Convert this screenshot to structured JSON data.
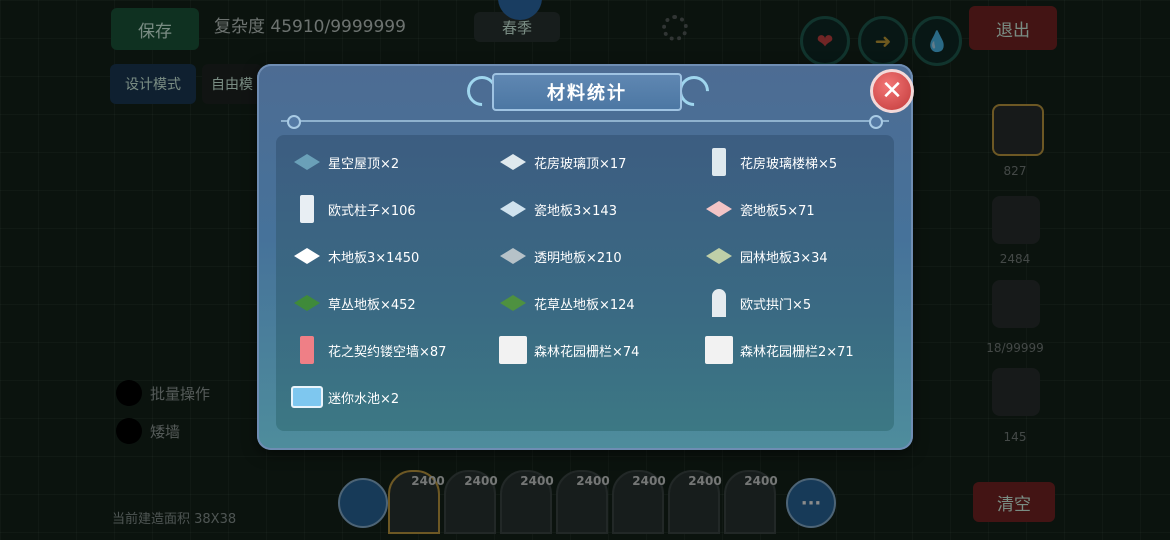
{
  "hud": {
    "save_label": "保存",
    "complexity_text": "复杂度 45910/9999999",
    "season_label": "春季",
    "exit_label": "退出",
    "design_mode_label": "设计模式",
    "free_mode_label": "自由模",
    "batch_label": "批量操作",
    "short_wall_label": "矮墙",
    "area_text": "当前建造面积 38X38",
    "clear_label": "清空",
    "more_label": "···"
  },
  "side_counts": [
    "827",
    "2484",
    "18/99999",
    "145"
  ],
  "bottom_counts": [
    "2400",
    "2400",
    "2400",
    "2400",
    "2400",
    "2400",
    "2400"
  ],
  "modal": {
    "title": "材料统计",
    "close_label": "✕",
    "items": [
      {
        "label": "星空屋顶×2",
        "icon": "starry-roof-icon",
        "color": "#6aa0b8"
      },
      {
        "label": "花房玻璃顶×17",
        "icon": "glass-roof-icon",
        "color": "#dfe9ee"
      },
      {
        "label": "花房玻璃楼梯×5",
        "icon": "glass-stairs-icon",
        "color": "#dfe9ee"
      },
      {
        "label": "欧式柱子×106",
        "icon": "column-icon",
        "color": "#e8eef3"
      },
      {
        "label": "瓷地板3×143",
        "icon": "tile-floor-icon",
        "color": "#cfe2ee"
      },
      {
        "label": "瓷地板5×71",
        "icon": "pink-tile-icon",
        "color": "#f2c4c6"
      },
      {
        "label": "木地板3×1450",
        "icon": "wood-floor-icon",
        "color": "#ffffff"
      },
      {
        "label": "透明地板×210",
        "icon": "clear-floor-icon",
        "color": "#b6c2c8"
      },
      {
        "label": "园林地板3×34",
        "icon": "garden-floor-icon",
        "color": "#bfcfa8"
      },
      {
        "label": "草丛地板×452",
        "icon": "grass-floor-icon",
        "color": "#3f8a3a"
      },
      {
        "label": "花草丛地板×124",
        "icon": "flower-grass-icon",
        "color": "#4e9140"
      },
      {
        "label": "欧式拱门×5",
        "icon": "arch-door-icon",
        "color": "#e5ebef"
      },
      {
        "label": "花之契约镂空墙×87",
        "icon": "lattice-wall-icon",
        "color": "#ef7f86"
      },
      {
        "label": "森林花园栅栏×74",
        "icon": "fence-icon",
        "color": "#f2f2f2"
      },
      {
        "label": "森林花园栅栏2×71",
        "icon": "fence2-icon",
        "color": "#f2f2f2"
      },
      {
        "label": "迷你水池×2",
        "icon": "mini-pool-icon",
        "color": "#7ec7ef"
      }
    ]
  }
}
